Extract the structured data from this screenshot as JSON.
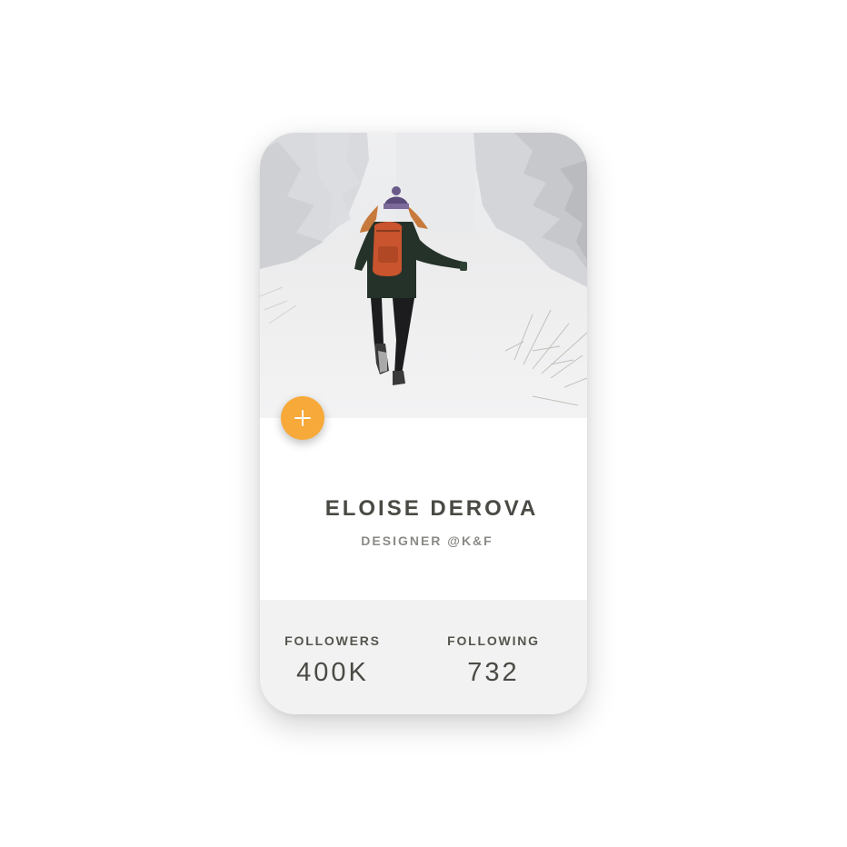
{
  "profile": {
    "name": "ELOISE DEROVA",
    "role": "DESIGNER @K&F"
  },
  "stats": [
    {
      "label": "FOLLOWERS",
      "value": "400K"
    },
    {
      "label": "FOLLOWING",
      "value": "732"
    }
  ],
  "actions": {
    "fab_icon": "plus-icon"
  },
  "colors": {
    "accent": "#f7a93a",
    "stats_background": "#f2f2f2",
    "text_dark": "#4a4a45",
    "text_muted": "#8a8a86"
  }
}
